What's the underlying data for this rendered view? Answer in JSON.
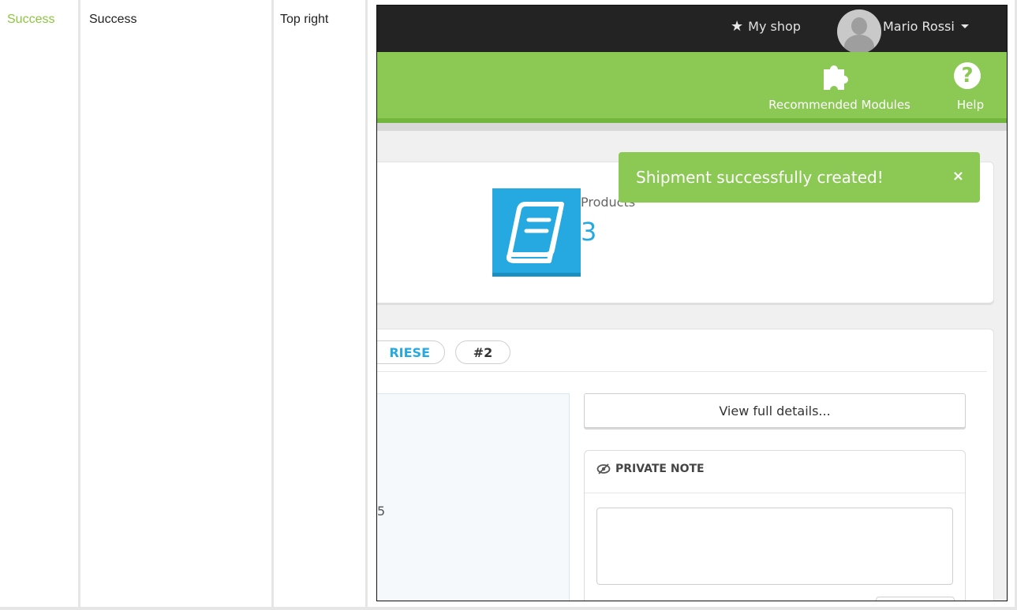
{
  "table_row": {
    "type_label": "Success",
    "class_label": "Success",
    "position": "Top right"
  },
  "header": {
    "my_shop": "My shop",
    "user_name": "Mario Rossi"
  },
  "toolbar": {
    "modules_label": "Recommended Modules",
    "help_label": "Help",
    "help_glyph": "?"
  },
  "alert": {
    "message": "Shipment successfully created!",
    "close": "×"
  },
  "kpi": {
    "label": "Products",
    "value": "3"
  },
  "order": {
    "carrier_badge": "RIESE",
    "number_badge": "#2",
    "truncated_value": "5"
  },
  "actions": {
    "view_details": "View full details..."
  },
  "private_note": {
    "title": "PRIVATE NOTE"
  },
  "colors": {
    "success_green": "#8bc954",
    "topbar": "#232323",
    "accent_blue": "#25a9e0"
  }
}
